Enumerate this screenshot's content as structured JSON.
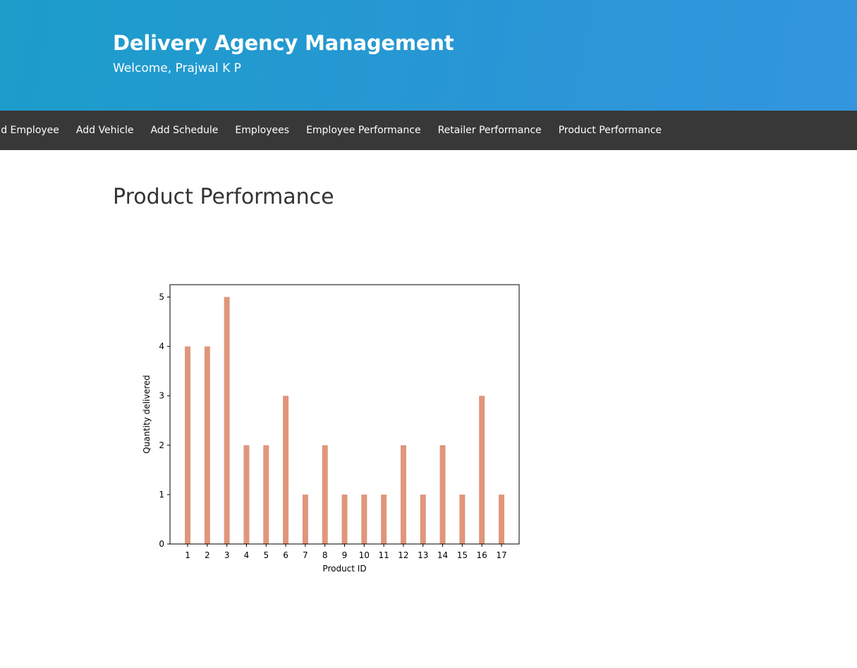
{
  "header": {
    "title": "Delivery Agency Management",
    "subtitle": "Welcome, Prajwal K P"
  },
  "nav": {
    "items": [
      {
        "label": "Add Employee"
      },
      {
        "label": "Add Vehicle"
      },
      {
        "label": "Add Schedule"
      },
      {
        "label": "Employees"
      },
      {
        "label": "Employee Performance"
      },
      {
        "label": "Retailer Performance"
      },
      {
        "label": "Product Performance"
      }
    ]
  },
  "main": {
    "title": "Product Performance"
  },
  "colors": {
    "header_bg": "#2196d2",
    "nav_bg": "#383838",
    "bar": "#e0967b"
  },
  "chart_data": {
    "type": "bar",
    "categories": [
      "1",
      "2",
      "3",
      "4",
      "5",
      "6",
      "7",
      "8",
      "9",
      "10",
      "11",
      "12",
      "13",
      "14",
      "15",
      "16",
      "17"
    ],
    "values": [
      4,
      4,
      5,
      2,
      2,
      3,
      1,
      2,
      1,
      1,
      1,
      2,
      1,
      2,
      1,
      3,
      1
    ],
    "title": "",
    "xlabel": "Product ID",
    "ylabel": "Quantity delivered",
    "ylim": [
      0,
      5.25
    ],
    "yticks": [
      0,
      1,
      2,
      3,
      4,
      5
    ],
    "grid": false,
    "bar_color": "#e0967b"
  }
}
